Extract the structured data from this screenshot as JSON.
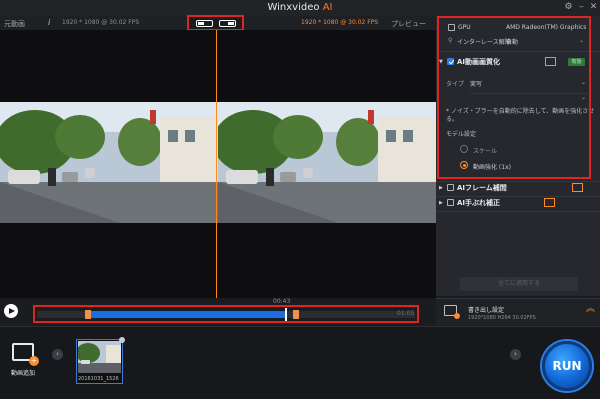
{
  "titlebar": {
    "app_name": "Winxvideo",
    "app_suffix": "AI"
  },
  "preview_header": {
    "left_label": "元動画",
    "edit_icon": "i",
    "left_resolution": "1920 * 1080 @ 30.02 FPS",
    "right_resolution": "1920 * 1080 @ 30.02 FPS",
    "right_label": "プレビュー"
  },
  "timeline": {
    "current_time": "00:43",
    "end_time": "01:05",
    "trim_start_fraction": 0.14,
    "trim_end_fraction": 0.66,
    "playhead_fraction": 0.66
  },
  "panel": {
    "gpu_label": "GPU",
    "gpu_value": "AMD Radeon(TM) Graphics",
    "deinterlace_label": "インターレース解除",
    "deinterlace_value": "自動",
    "ai_enhance_label": "AI動画画質化",
    "ai_enhance_badge": "有効",
    "type_label": "タイプ",
    "type_value": "実写",
    "description": "* ノイズ・ブラーを自動的に除去して、動画を強化させる。",
    "model_label": "モデル設定",
    "model_option_1": "スケール",
    "model_option_2": "動画強化 (1x)",
    "frame_interp_label": "AIフレーム補間",
    "stabilize_label": "AI手ぶれ補正",
    "apply_button": "全てに適用する"
  },
  "export": {
    "title": "書き出し設定",
    "details": "1920*1080  H264  30.02FPS"
  },
  "bottom": {
    "add_video_label": "動画追加",
    "thumb_caption": "20161031_1526",
    "run_label": "RUN"
  },
  "colors": {
    "accent": "#ff8a2a",
    "highlight": "#e02424",
    "progress": "#1a6fe0",
    "run": "#1066d6"
  }
}
